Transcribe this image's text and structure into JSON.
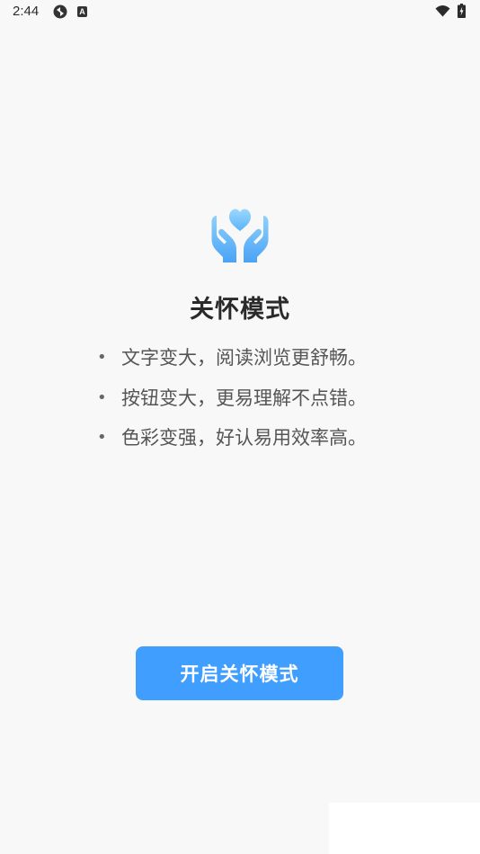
{
  "status_bar": {
    "time": "2:44",
    "app_badge": "A"
  },
  "colors": {
    "accent": "#409eff",
    "icon_gradient_light": "#8ed1fb",
    "icon_gradient_dark": "#4aa3f6",
    "background": "#f8f8f8"
  },
  "icons": [
    "sync-icon",
    "app-a-icon",
    "wifi-icon",
    "battery-icon",
    "care-hands-heart-icon"
  ],
  "main": {
    "title": "关怀模式",
    "bullet": "•",
    "features": [
      "文字变大，阅读浏览更舒畅。",
      "按钮变大，更易理解不点错。",
      "色彩变强，好认易用效率高。"
    ],
    "enable_button_label": "开启关怀模式"
  }
}
